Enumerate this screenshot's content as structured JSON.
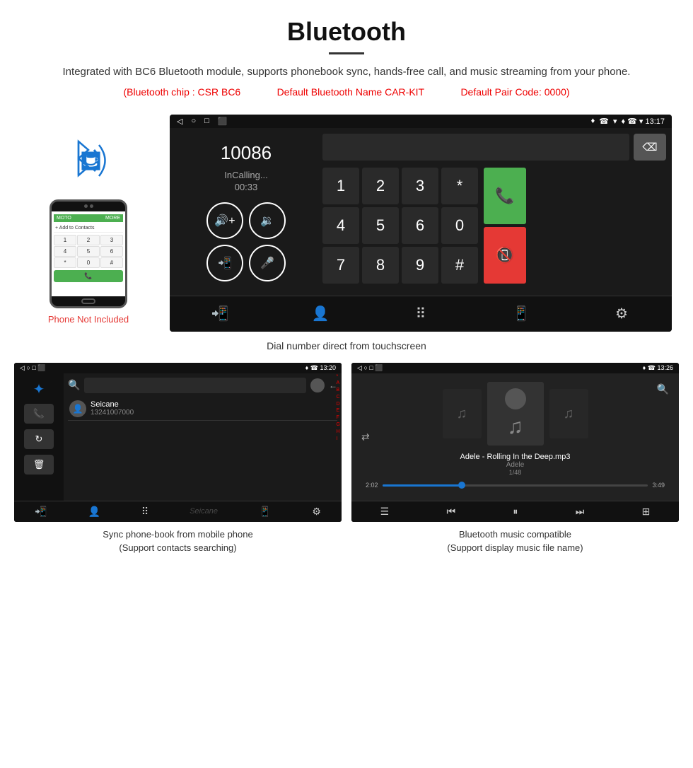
{
  "page": {
    "title": "Bluetooth",
    "divider": true,
    "description": "Integrated with BC6 Bluetooth module, supports phonebook sync, hands-free call, and music streaming from your phone.",
    "specs": {
      "chip": "(Bluetooth chip : CSR BC6",
      "name": "Default Bluetooth Name CAR-KIT",
      "pair_code": "Default Pair Code: 0000)"
    }
  },
  "phone_area": {
    "not_included_text": "Phone Not Included"
  },
  "car_screen": {
    "statusbar": {
      "back": "◁",
      "circle": "○",
      "square": "□",
      "sim": "⬛",
      "right_icons": "♦ ☎ ▾ 13:17"
    },
    "dial": {
      "number": "10086",
      "status": "InCalling...",
      "timer": "00:33"
    },
    "numpad": {
      "keys": [
        "1",
        "2",
        "3",
        "*",
        "4",
        "5",
        "6",
        "0",
        "7",
        "8",
        "9",
        "#"
      ]
    },
    "call_caption": "Dial number direct from touchscreen"
  },
  "phonebook_screen": {
    "statusbar_right": "♦ ☎ 13:20",
    "contact_name": "Seicane",
    "contact_phone": "13241007000",
    "alpha": [
      "*",
      "A",
      "B",
      "C",
      "D",
      "E",
      "F",
      "G",
      "H",
      "I"
    ],
    "caption_line1": "Sync phone-book from mobile phone",
    "caption_line2": "(Support contacts searching)"
  },
  "music_screen": {
    "statusbar_right": "♦ ☎ 13:26",
    "song": "Adele - Rolling In the Deep.mp3",
    "artist": "Adele",
    "track_info": "1/48",
    "time_current": "2:02",
    "time_total": "3:49",
    "progress_percent": 30,
    "caption_line1": "Bluetooth music compatible",
    "caption_line2": "(Support display music file name)"
  },
  "icons": {
    "bluetooth": "✦",
    "back_nav": "◁",
    "circle_nav": "○",
    "square_nav": "□",
    "sim_nav": "⬛",
    "phone_call": "📞",
    "end_call": "📵",
    "volume_up": "🔊",
    "volume_down": "🔉",
    "mute": "🔇",
    "mic": "🎤",
    "transfer": "📲",
    "contacts": "👤",
    "dialpad": "⠿",
    "settings": "⚙",
    "search": "🔍",
    "music_note": "♫",
    "shuffle": "⇄",
    "prev": "⏮",
    "play": "⏸",
    "next": "⏭",
    "menu": "☰",
    "eq": "⊞",
    "trash": "🗑",
    "sync": "↻"
  }
}
